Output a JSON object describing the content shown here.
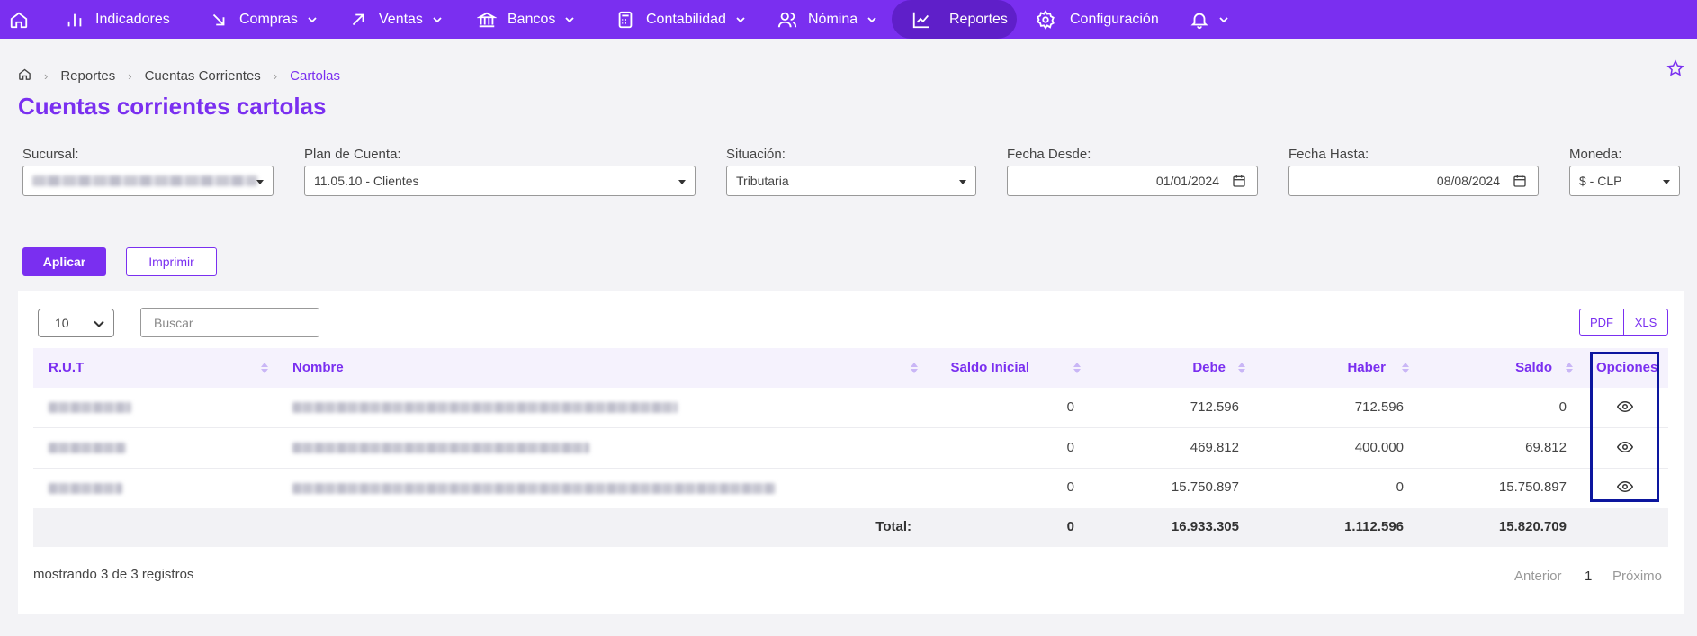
{
  "nav": {
    "items": [
      {
        "label": "Indicadores"
      },
      {
        "label": "Compras"
      },
      {
        "label": "Ventas"
      },
      {
        "label": "Bancos"
      },
      {
        "label": "Contabilidad"
      },
      {
        "label": "Nómina"
      },
      {
        "label": "Reportes",
        "active": true
      },
      {
        "label": "Configuración"
      }
    ],
    "accent": "#7a2ff0"
  },
  "breadcrumb": [
    "Reportes",
    "Cuentas Corrientes",
    "Cartolas"
  ],
  "page_title": "Cuentas corrientes cartolas",
  "filters": {
    "sucursal": {
      "label": "Sucursal:",
      "value": ""
    },
    "plan": {
      "label": "Plan de Cuenta:",
      "value": "11.05.10 - Clientes"
    },
    "situacion": {
      "label": "Situación:",
      "value": "Tributaria"
    },
    "desde": {
      "label": "Fecha Desde:",
      "value": "01/01/2024"
    },
    "hasta": {
      "label": "Fecha Hasta:",
      "value": "08/08/2024"
    },
    "moneda": {
      "label": "Moneda:",
      "value": "$ - CLP"
    }
  },
  "buttons": {
    "apply": "Aplicar",
    "print": "Imprimir",
    "pdf": "PDF",
    "xls": "XLS"
  },
  "table": {
    "page_length": "10",
    "search_placeholder": "Buscar",
    "headers": {
      "rut": "R.U.T",
      "nombre": "Nombre",
      "saldo_inicial": "Saldo Inicial",
      "debe": "Debe",
      "haber": "Haber",
      "saldo": "Saldo",
      "opciones": "Opciones"
    },
    "rows": [
      {
        "saldo_inicial": "0",
        "debe": "712.596",
        "haber": "712.596",
        "saldo": "0"
      },
      {
        "saldo_inicial": "0",
        "debe": "469.812",
        "haber": "400.000",
        "saldo": "69.812"
      },
      {
        "saldo_inicial": "0",
        "debe": "15.750.897",
        "haber": "0",
        "saldo": "15.750.897"
      }
    ],
    "totals": {
      "label": "Total:",
      "saldo_inicial": "0",
      "debe": "16.933.305",
      "haber": "1.112.596",
      "saldo": "15.820.709"
    }
  },
  "footer": {
    "info": "mostrando 3 de 3 registros",
    "prev": "Anterior",
    "page": "1",
    "next": "Próximo"
  }
}
